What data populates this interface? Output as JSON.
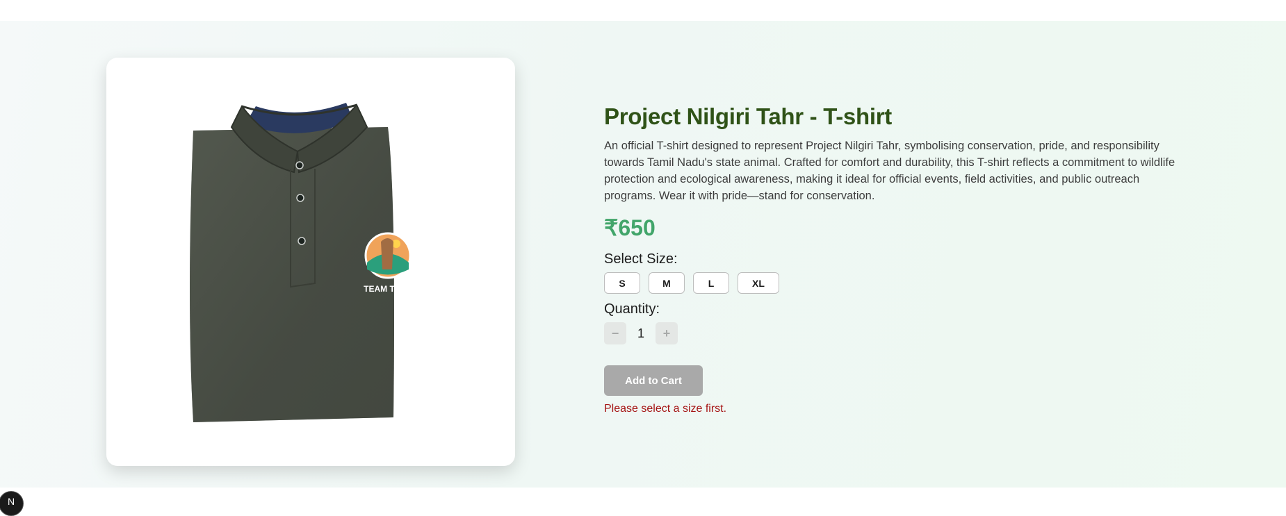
{
  "product": {
    "title": "Project Nilgiri Tahr - T-shirt",
    "description": "An official T-shirt designed to represent Project Nilgiri Tahr, symbolising conservation, pride, and responsibility towards Tamil Nadu's state animal. Crafted for comfort and durability, this T-shirt reflects a commitment to wildlife protection and ecological awareness, making it ideal for official events, field activities, and public outreach programs. Wear it with pride—stand for conservation.",
    "price": "₹650",
    "image_badge_text": "TEAM TAHR",
    "image_alt": "Olive green polo T-shirt with Team Tahr logo"
  },
  "size": {
    "label": "Select Size:",
    "options": [
      "S",
      "M",
      "L",
      "XL"
    ]
  },
  "quantity": {
    "label": "Quantity:",
    "value": "1",
    "decrement_icon": "minus-icon",
    "increment_icon": "plus-icon"
  },
  "cart": {
    "add_label": "Add to Cart",
    "error": "Please select a size first."
  },
  "badge": {
    "text": "N"
  },
  "colors": {
    "title": "#2f5217",
    "price": "#42a56a",
    "error": "#a51313",
    "shirt": "#494f45",
    "button_disabled": "#a9a9a9"
  }
}
